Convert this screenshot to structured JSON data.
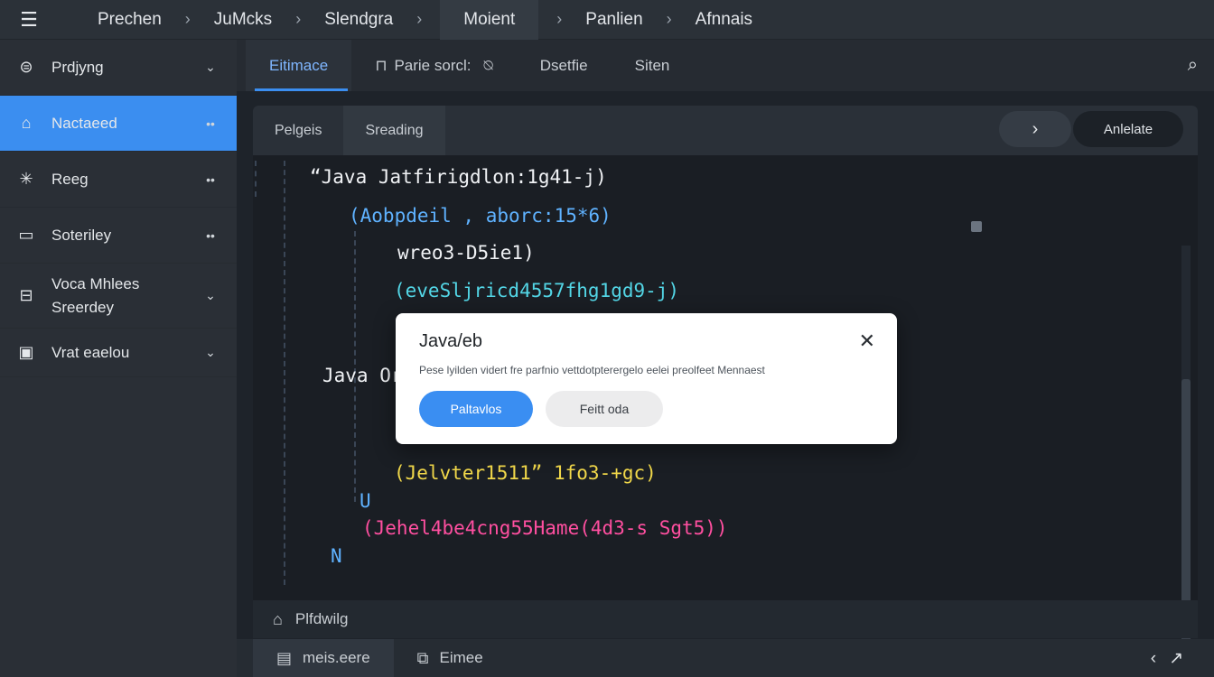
{
  "topbar": {
    "menu_icon": "menu-icon",
    "crumbs": [
      "Prechen",
      "JuMcks",
      "Slendgra",
      "Moient",
      "Panlien",
      "Afnnais"
    ],
    "separator": "›"
  },
  "sidebar": {
    "items": [
      {
        "label": "Prdjyng",
        "icon": "layers-icon",
        "tail": "chevron-down"
      },
      {
        "label": "Nactaeed",
        "icon": "home-icon",
        "tail": "more-dots"
      },
      {
        "label": "Reeg",
        "icon": "asterisk-icon",
        "tail": "more-dots"
      },
      {
        "label": "Soteriley",
        "icon": "folder-icon",
        "tail": "more-dots"
      },
      {
        "label": "Voca Mhlees Sreerdey",
        "icon": "inbox-icon",
        "tail": "chevron-down"
      },
      {
        "label": "Vrat eaelou",
        "icon": "drive-icon",
        "tail": "chevron-down"
      }
    ],
    "active_index": 1
  },
  "tabs": {
    "items": [
      "Eitimace",
      "Parie sorcl:",
      "Dsetfie",
      "Siten"
    ],
    "tab2_icon": "lock-icon",
    "tab2_suffix_icon": "tag-icon",
    "active_index": 0,
    "search_icon": "search-icon"
  },
  "panel": {
    "tabs": [
      "Pelgeis",
      "Sreading"
    ],
    "selected_index": 1,
    "next_icon": "chevron-right-icon",
    "apply_label": "Anlelate"
  },
  "code": {
    "lines": [
      "“Java Jatfirigdlon:1g41-j)",
      "(Aobpdeil , aborc:15*6)",
      "wreo3-D5ie1)",
      "(eveSljricd4557fhg1gd9-j)",
      "Java Or",
      "(Jelvter1511” 1fo3-+gc)",
      "U",
      "(Jehel4be4cng55Hame(4d3-s Sgt5))",
      "N"
    ]
  },
  "status": {
    "icon": "home-icon",
    "label": "Plfdwilg"
  },
  "bottom": {
    "tabs": [
      {
        "label": "meis.eere",
        "icon": "file-icon"
      },
      {
        "label": "Eimee",
        "icon": "external-icon"
      }
    ],
    "selected_index": 0,
    "nav_icons": [
      "back-icon",
      "expand-icon"
    ]
  },
  "modal": {
    "title": "Java/eb",
    "message": "Pese lyilden vidert fre parfnio vettdotpterergelo eelei preolfeet Mennaest",
    "primary_label": "Paltavlos",
    "secondary_label": "Feitt oda",
    "close_icon": "close-icon"
  },
  "colors": {
    "accent": "#3b8ef0",
    "sidebar_bg": "#2a2f36",
    "editor_bg": "#1a1e24"
  }
}
